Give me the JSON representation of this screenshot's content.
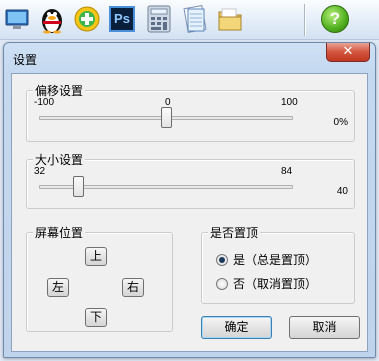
{
  "taskbar": {
    "icons": [
      {
        "name": "computer-icon"
      },
      {
        "name": "qq-penguin-icon"
      },
      {
        "name": "360-plus-icon"
      },
      {
        "name": "photoshop-icon",
        "label": "Ps"
      },
      {
        "name": "calculator-icon"
      },
      {
        "name": "notepad-icon"
      },
      {
        "name": "folder-icon"
      },
      {
        "name": "help-icon",
        "label": "?"
      }
    ]
  },
  "window": {
    "title": "设置",
    "close_label": "✕"
  },
  "offset": {
    "legend": "偏移设置",
    "min": "-100",
    "mid": "0",
    "max": "100",
    "value_text": "0%",
    "value": 0,
    "range": [
      -100,
      100
    ]
  },
  "size": {
    "legend": "大小设置",
    "min": "32",
    "max": "84",
    "value_text": "40",
    "value": 40,
    "range": [
      32,
      84
    ]
  },
  "screen_pos": {
    "legend": "屏幕位置",
    "up": "上",
    "left": "左",
    "right": "右",
    "down": "下"
  },
  "topmost": {
    "legend": "是否置顶",
    "yes_label": "是（总是置顶）",
    "no_label": "否（取消置顶）",
    "selected": "yes"
  },
  "buttons": {
    "ok": "确定",
    "cancel": "取消"
  },
  "colors": {
    "window_frame": "#6e8aac",
    "close_red": "#c1371f",
    "dialog_bg": "#f0f0f0"
  }
}
